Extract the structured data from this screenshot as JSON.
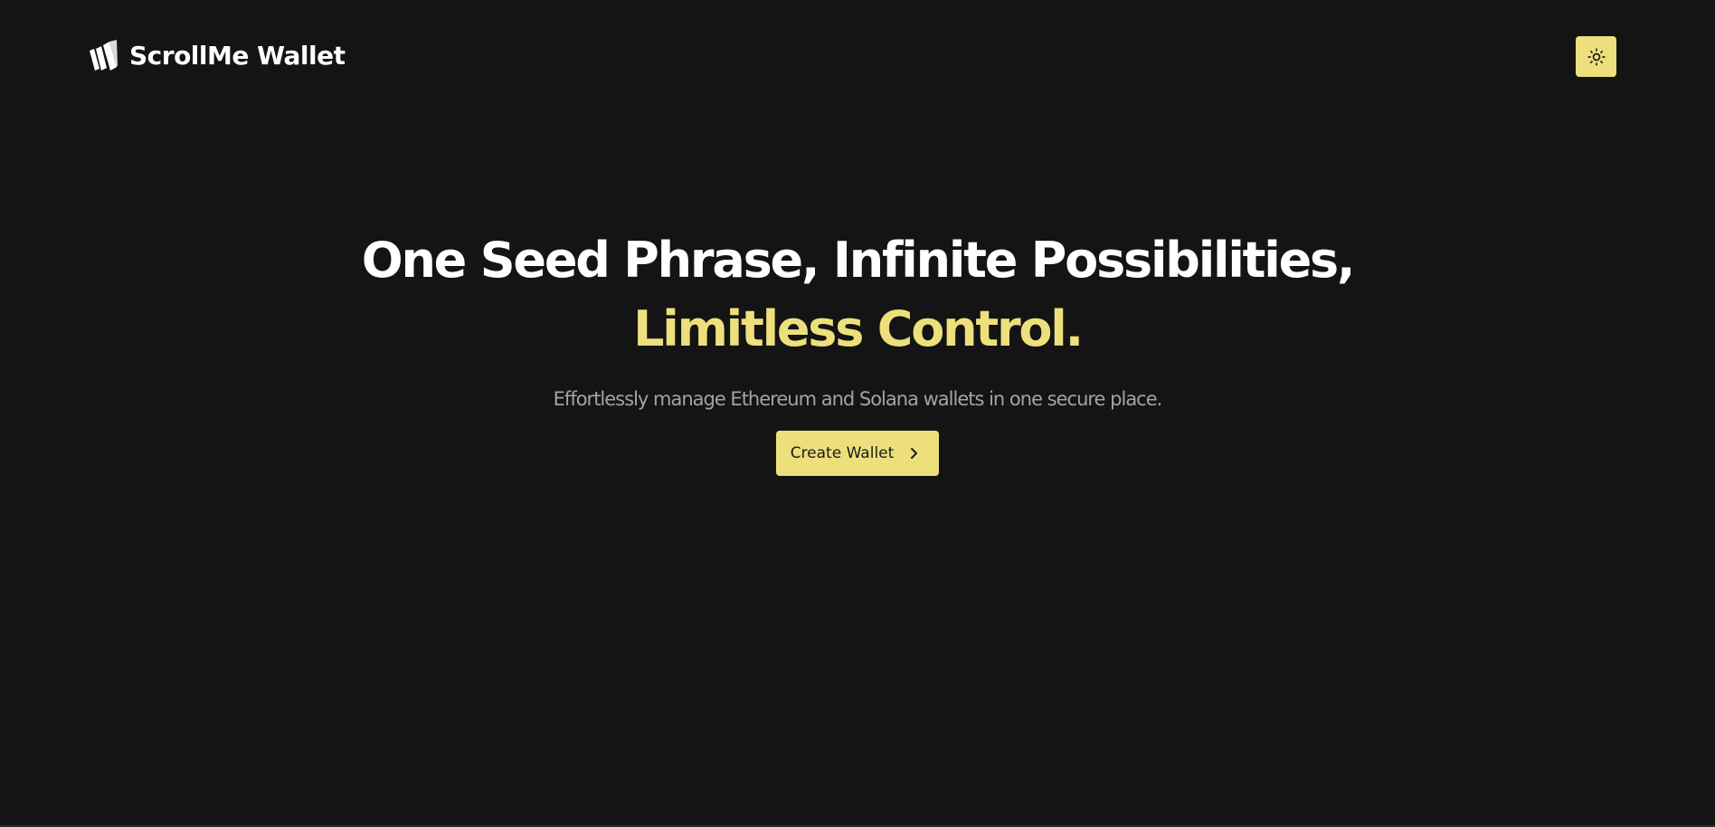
{
  "header": {
    "brand_name": "ScrollMe Wallet",
    "logo_icon": "brand-logo-icon",
    "theme_toggle_icon": "sun-icon"
  },
  "hero": {
    "headline_line1": "One Seed Phrase, Infinite Possibilities,",
    "headline_line2": "Limitless Control.",
    "subtitle": "Effortlessly manage Ethereum and Solana wallets in one secure place.",
    "cta_label": "Create Wallet",
    "cta_icon": "chevron-right-icon"
  },
  "colors": {
    "background": "#141414",
    "accent": "#ede07c",
    "headline": "#ffffff",
    "subtitle": "#a3a3a3",
    "button_text": "#1a1a1a"
  }
}
